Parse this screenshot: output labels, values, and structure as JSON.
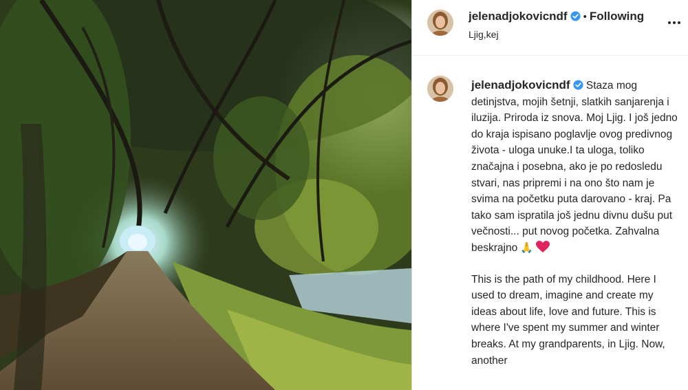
{
  "post": {
    "username": "jelenadjokovicndf",
    "separator": "•",
    "follow_status": "Following",
    "location": "Ljig,kej"
  },
  "caption": {
    "username": "jelenadjokovicndf",
    "text_sr": "Staza mog detinjstva, mojih šetnji, slatkih sanjarenja i iluzija. Priroda iz snova. Moj Ljig. I još jedno do kraja ispisano poglavlje ovog predivnog života - uloga unuke.I ta uloga, toliko značajna i posebna, ako je po redosledu stvari, nas pripremi i na ono što nam je svima na početku puta darovano - kraj. Pa tako sam ispratila još jednu divnu dušu put večnosti... put novog početka. Zahvalna beskrajno",
    "emoji_pray": "🙏",
    "text_en": "This is the path of my childhood. Here I used to dream, imagine and create my ideas about life, love and future. This is where I've spent my summer and winter breaks. At my grandparents, in Ljig. Now, another"
  },
  "icons": {
    "verified": "verified-badge-icon",
    "more": "more-options-icon",
    "heart": "red-heart-emoji"
  },
  "colors": {
    "verified_blue": "#3897f0",
    "heart_red": "#e0245e",
    "text": "#262626"
  }
}
